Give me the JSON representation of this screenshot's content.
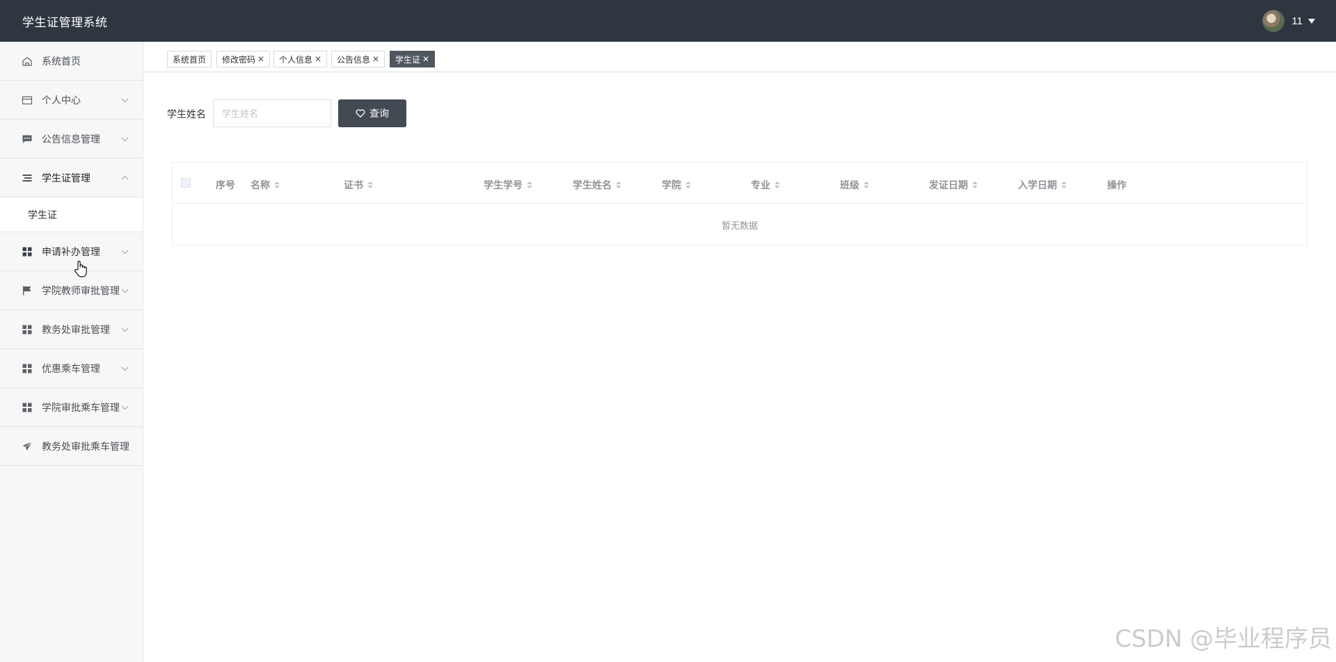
{
  "app": {
    "title": "学生证管理系统"
  },
  "user": {
    "name": "11"
  },
  "sidebar": {
    "items": [
      {
        "label": "系统首页",
        "icon": "home-icon"
      },
      {
        "label": "个人中心",
        "icon": "card-icon"
      },
      {
        "label": "公告信息管理",
        "icon": "message-icon"
      },
      {
        "label": "学生证管理",
        "icon": "list-icon"
      },
      {
        "label": "申请补办管理",
        "icon": "grid-icon"
      },
      {
        "label": "学院教师审批管理",
        "icon": "flag-icon"
      },
      {
        "label": "教务处审批管理",
        "icon": "grid-icon"
      },
      {
        "label": "优惠乘车管理",
        "icon": "grid-icon"
      },
      {
        "label": "学院审批乘车管理",
        "icon": "grid-icon"
      },
      {
        "label": "教务处审批乘车管理",
        "icon": "send-icon"
      }
    ],
    "submenu": {
      "label": "学生证"
    }
  },
  "tabs": [
    {
      "label": "系统首页"
    },
    {
      "label": "修改密码"
    },
    {
      "label": "个人信息"
    },
    {
      "label": "公告信息"
    },
    {
      "label": "学生证"
    }
  ],
  "search": {
    "label": "学生姓名",
    "placeholder": "学生姓名",
    "button_label": "查询"
  },
  "table": {
    "headers": [
      "序号",
      "名称",
      "证书",
      "学生学号",
      "学生姓名",
      "学院",
      "专业",
      "班级",
      "发证日期",
      "入学日期",
      "操作"
    ],
    "empty_text": "暂无数据"
  },
  "watermark": "CSDN @毕业程序员"
}
